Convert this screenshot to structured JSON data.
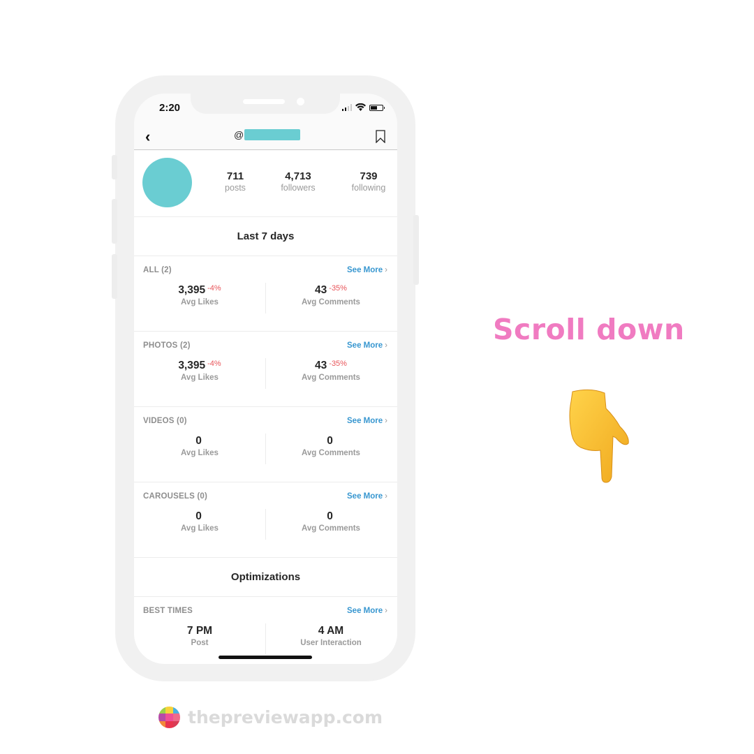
{
  "status_bar": {
    "time": "2:20",
    "battery_level": 0.6,
    "signal_bars": 2
  },
  "nav": {
    "handle_prefix": "@",
    "back_icon": "chevron-left-icon",
    "bookmark_icon": "bookmark-icon"
  },
  "profile": {
    "stats": [
      {
        "value": "711",
        "label": "posts"
      },
      {
        "value": "4,713",
        "label": "followers"
      },
      {
        "value": "739",
        "label": "following"
      }
    ]
  },
  "sections": {
    "last7_title": "Last 7 days",
    "optimizations_title": "Optimizations"
  },
  "cards": [
    {
      "title": "ALL (2)",
      "see_more": "See More",
      "left": {
        "value": "3,395",
        "delta": "-4%",
        "label": "Avg Likes"
      },
      "right": {
        "value": "43",
        "delta": "-35%",
        "label": "Avg Comments"
      }
    },
    {
      "title": "PHOTOS (2)",
      "see_more": "See More",
      "left": {
        "value": "3,395",
        "delta": "-4%",
        "label": "Avg Likes"
      },
      "right": {
        "value": "43",
        "delta": "-35%",
        "label": "Avg Comments"
      }
    },
    {
      "title": "VIDEOS (0)",
      "see_more": "See More",
      "left": {
        "value": "0",
        "delta": "",
        "label": "Avg Likes"
      },
      "right": {
        "value": "0",
        "delta": "",
        "label": "Avg Comments"
      }
    },
    {
      "title": "CAROUSELS (0)",
      "see_more": "See More",
      "left": {
        "value": "0",
        "delta": "",
        "label": "Avg Likes"
      },
      "right": {
        "value": "0",
        "delta": "",
        "label": "Avg Comments"
      }
    }
  ],
  "best_times": {
    "title": "BEST TIMES",
    "see_more": "See More",
    "left": {
      "value": "7 PM",
      "label": "Post"
    },
    "right": {
      "value": "4 AM",
      "label": "User Interaction"
    }
  },
  "promo": {
    "cta": "Scroll down",
    "cta_icon": "pointing-down-hand-icon",
    "brand": "thepreviewapp.com"
  },
  "colors": {
    "accent_teal": "#6acdd2",
    "link_blue": "#3897d0",
    "negative_red": "#e8555a",
    "cta_pink": "#f07bc1"
  }
}
